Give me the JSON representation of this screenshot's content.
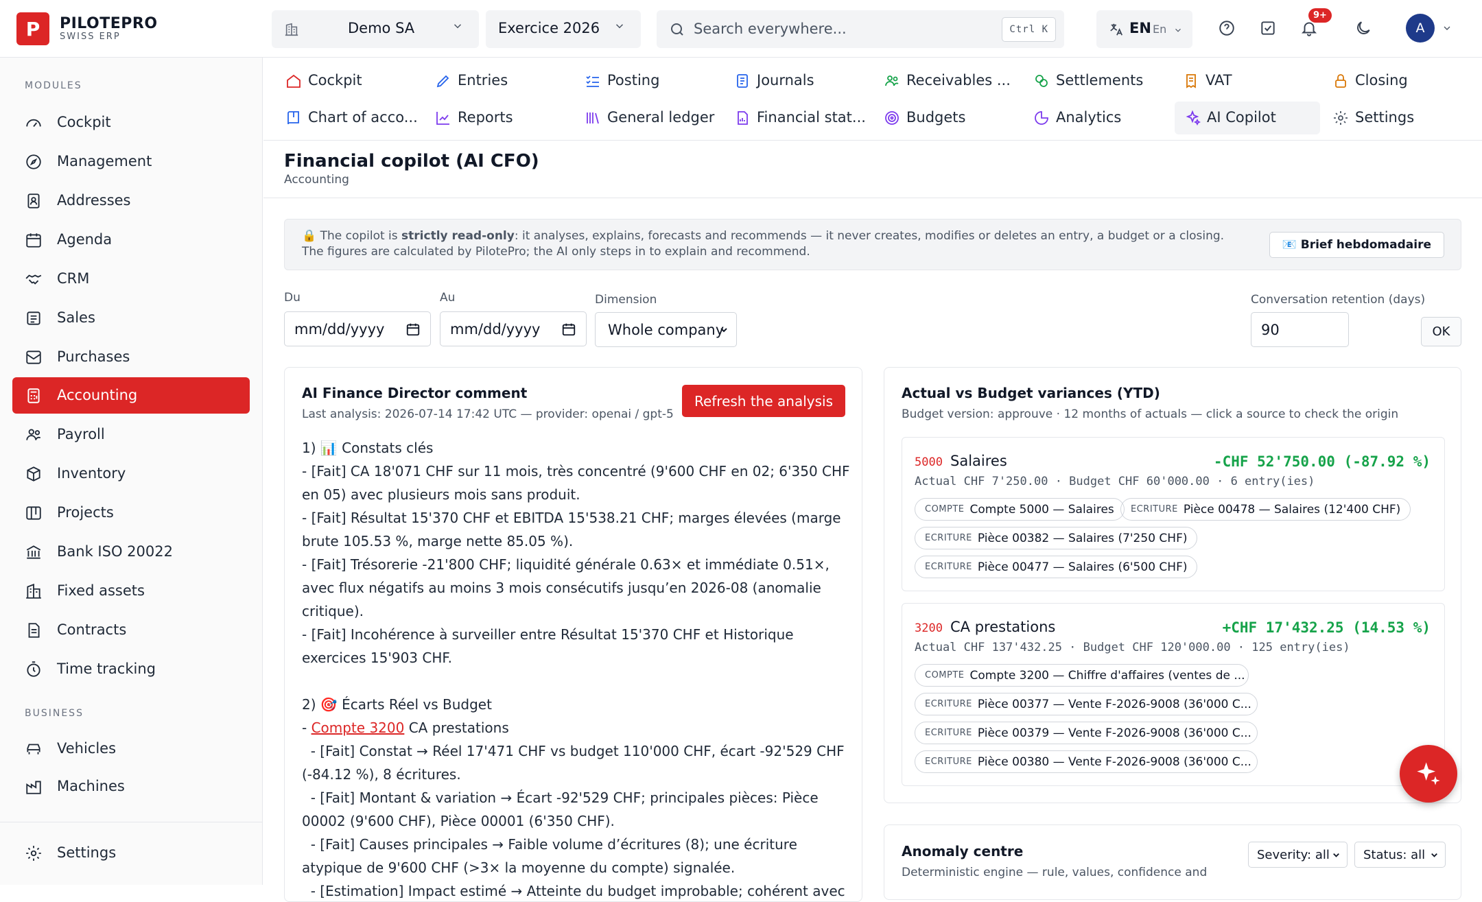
{
  "brand": {
    "name": "PILOTEPRO",
    "tagline": "SWISS ERP",
    "logo_letter": "P"
  },
  "topbar": {
    "company": "Demo SA",
    "fiscal_year": "Exercice 2026",
    "search_placeholder": "Search everywhere...",
    "search_shortcut": "Ctrl K",
    "language": "EN",
    "language_sub": "En",
    "notifications_badge": "9+",
    "avatar_initial": "A"
  },
  "sidebar": {
    "modules_heading": "MODULES",
    "modules": [
      {
        "label": "Cockpit",
        "icon": "gauge-icon"
      },
      {
        "label": "Management",
        "icon": "compass-icon"
      },
      {
        "label": "Addresses",
        "icon": "contact-book-icon"
      },
      {
        "label": "Agenda",
        "icon": "calendar-icon"
      },
      {
        "label": "CRM",
        "icon": "handshake-icon"
      },
      {
        "label": "Sales",
        "icon": "receipt-icon"
      },
      {
        "label": "Purchases",
        "icon": "inbox-icon"
      },
      {
        "label": "Accounting",
        "icon": "calculator-icon",
        "active": true
      },
      {
        "label": "Payroll",
        "icon": "users-icon"
      },
      {
        "label": "Inventory",
        "icon": "box-icon"
      },
      {
        "label": "Projects",
        "icon": "kanban-icon"
      },
      {
        "label": "Bank ISO 20022",
        "icon": "bank-icon"
      },
      {
        "label": "Fixed assets",
        "icon": "building-icon"
      },
      {
        "label": "Contracts",
        "icon": "contract-icon"
      },
      {
        "label": "Time tracking",
        "icon": "stopwatch-icon"
      }
    ],
    "business_heading": "BUSINESS",
    "business": [
      {
        "label": "Vehicles",
        "icon": "car-icon"
      },
      {
        "label": "Machines",
        "icon": "factory-icon"
      }
    ],
    "settings_label": "Settings"
  },
  "module_nav": [
    {
      "label": "Cockpit",
      "icon": "home-icon"
    },
    {
      "label": "Entries",
      "icon": "pen-icon"
    },
    {
      "label": "Posting",
      "icon": "checklist-icon"
    },
    {
      "label": "Journals",
      "icon": "notebook-icon"
    },
    {
      "label": "Receivables ...",
      "icon": "people-icon"
    },
    {
      "label": "Settlements",
      "icon": "coins-icon"
    },
    {
      "label": "VAT",
      "icon": "receipt-icon"
    },
    {
      "label": "Closing",
      "icon": "lock-icon"
    },
    {
      "label": "Chart of acco...",
      "icon": "book-icon"
    },
    {
      "label": "Reports",
      "icon": "line-chart-icon"
    },
    {
      "label": "General ledger",
      "icon": "library-icon"
    },
    {
      "label": "Financial stat...",
      "icon": "file-chart-icon"
    },
    {
      "label": "Budgets",
      "icon": "target-icon"
    },
    {
      "label": "Analytics",
      "icon": "pie-chart-icon"
    },
    {
      "label": "AI Copilot",
      "icon": "sparkles-icon",
      "active": true
    },
    {
      "label": "Settings",
      "icon": "gear-icon"
    }
  ],
  "page": {
    "title": "Financial copilot (AI CFO)",
    "subtitle": "Accounting"
  },
  "notice": {
    "lock": "🔒",
    "prefix": "The copilot is ",
    "emphasis": "strictly read-only",
    "rest": ": it analyses, explains, forecasts and recommends — it never creates, modifies or deletes an entry, a budget or a closing. The figures are calculated by PilotePro; the AI only steps in to explain and recommend.",
    "brief_button": "📧 Brief hebdomadaire"
  },
  "filters": {
    "from_label": "Du",
    "from_placeholder": "mm/dd/yyyy",
    "to_label": "Au",
    "to_placeholder": "mm/dd/yyyy",
    "dimension_label": "Dimension",
    "dimension_value": "Whole company",
    "retention_label": "Conversation retention (days)",
    "retention_value": "90",
    "ok_button": "OK"
  },
  "ai_comment": {
    "title": "AI Finance Director comment",
    "meta": "Last analysis: 2026-07-14 17:42 UTC — provider: openai / gpt-5",
    "refresh_button": "Refresh the analysis",
    "before_link": "1) 📊 Constats clés\n- [Fait] CA 18'071 CHF sur 11 mois, très concentré (9'600 CHF en 02; 6'350 CHF en 05) avec plusieurs mois sans produit.\n- [Fait] Résultat 15'370 CHF et EBITDA 15'538.21 CHF; marges élevées (marge brute 105.53 %, marge nette 85.05 %).\n- [Fait] Trésorerie -21'800 CHF; liquidité générale 0.63× et immédiate 0.51×, avec flux négatifs au moins 3 mois consécutifs jusqu’en 2026-08 (anomalie critique).\n- [Fait] Incohérence à surveiller entre Résultat 15'370 CHF et Historique exercices 15'903 CHF.\n\n2) 🎯 Écarts Réel vs Budget\n- ",
    "link": "Compte 3200",
    "after_link": " CA prestations\n  - [Fait] Constat → Réel 17'471 CHF vs budget 110'000 CHF, écart -92'529 CHF (-84.12 %), 8 écritures.\n  - [Fait] Montant & variation → Écart -92'529 CHF; principales pièces: Pièce 00002 (9'600 CHF), Pièce 00001 (6'350 CHF).\n  - [Fait] Causes principales → Faible volume d’écritures (8); une écriture atypique de 9'600 CHF (>3× la moyenne du compte) signalée.\n  - [Estimation] Impact estimé → Atteinte du budget improbable; cohérent avec les"
  },
  "variances": {
    "title": "Actual vs Budget variances (YTD)",
    "subtitle": "Budget version: approuve · 12 months of actuals — click a source to check the origin",
    "items": [
      {
        "code": "5000",
        "name": "Salaires",
        "delta": "-CHF 52'750.00 (-87.92 %)",
        "meta": "Actual CHF 7'250.00 · Budget CHF 60'000.00 · 6 entry(ies)",
        "chips": [
          {
            "kind": "COMPTE",
            "text": "Compte 5000 — Salaires"
          },
          {
            "kind": "ECRITURE",
            "text": "Pièce 00478 — Salaires (12'400 CHF)"
          },
          {
            "kind": "ECRITURE",
            "text": "Pièce 00382 — Salaires (7'250 CHF)"
          },
          {
            "kind": "ECRITURE",
            "text": "Pièce 00477 — Salaires (6'500 CHF)"
          }
        ]
      },
      {
        "code": "3200",
        "name": "CA prestations",
        "delta": "+CHF 17'432.25 (14.53 %)",
        "meta": "Actual CHF 137'432.25 · Budget CHF 120'000.00 · 125 entry(ies)",
        "chips": [
          {
            "kind": "COMPTE",
            "text": "Compte 3200 — Chiffre d'affaires (ventes de ..."
          },
          {
            "kind": "ECRITURE",
            "text": "Pièce 00377 — Vente F-2026-9008 (36'000 C..."
          },
          {
            "kind": "ECRITURE",
            "text": "Pièce 00379 — Vente F-2026-9008 (36'000 C..."
          },
          {
            "kind": "ECRITURE",
            "text": "Pièce 00380 — Vente F-2026-9008 (36'000 C..."
          }
        ]
      }
    ]
  },
  "anomaly": {
    "title": "Anomaly centre",
    "subtitle": "Deterministic engine — rule, values, confidence and",
    "severity": "Severity: all",
    "status": "Status: all"
  },
  "colors": {
    "accent": "#dc2626",
    "positive": "#16a34a",
    "navy": "#1e3a8a"
  }
}
